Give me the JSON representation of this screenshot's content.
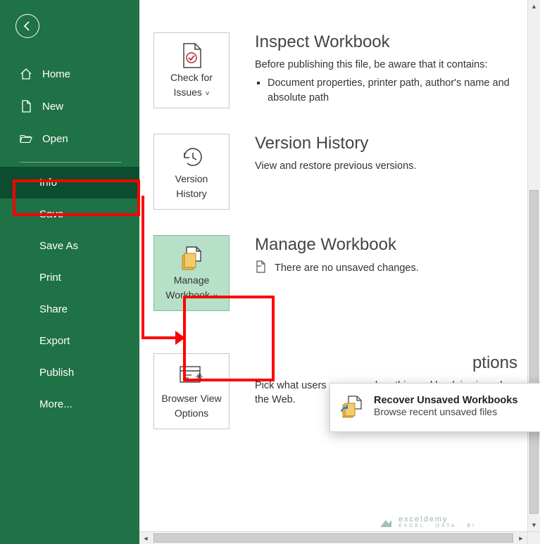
{
  "sidebar": {
    "items": [
      {
        "label": "Home"
      },
      {
        "label": "New"
      },
      {
        "label": "Open"
      },
      {
        "label": "Info"
      },
      {
        "label": "Save"
      },
      {
        "label": "Save As"
      },
      {
        "label": "Print"
      },
      {
        "label": "Share"
      },
      {
        "label": "Export"
      },
      {
        "label": "Publish"
      },
      {
        "label": "More..."
      }
    ],
    "selected_index": 3
  },
  "sections": {
    "inspect": {
      "tile_label_1": "Check for",
      "tile_label_2": "Issues",
      "title": "Inspect Workbook",
      "intro": "Before publishing this file, be aware that it contains:",
      "bullets": [
        "Document properties, printer path, author's name and absolute path"
      ]
    },
    "version": {
      "tile_label_1": "Version",
      "tile_label_2": "History",
      "title": "Version History",
      "text": "View and restore previous versions."
    },
    "manage": {
      "tile_label_1": "Manage",
      "tile_label_2": "Workbook",
      "title": "Manage Workbook",
      "status": "There are no unsaved changes."
    },
    "browser": {
      "tile_label_1": "Browser View",
      "tile_label_2": "Options",
      "title_suffix": "ptions",
      "text": "Pick what users can see when this workbook is viewed on the Web."
    }
  },
  "dropdown": {
    "item_title": "Recover Unsaved Workbooks",
    "item_sub": "Browse recent unsaved files"
  },
  "watermark": {
    "brand": "exceldemy",
    "tag": "EXCEL · DATA · BI"
  },
  "colors": {
    "sidebar": "#1f7246",
    "selected": "#0b4d2e",
    "highlight": "#ff0000",
    "tile_hl": "#b6e0c7"
  }
}
